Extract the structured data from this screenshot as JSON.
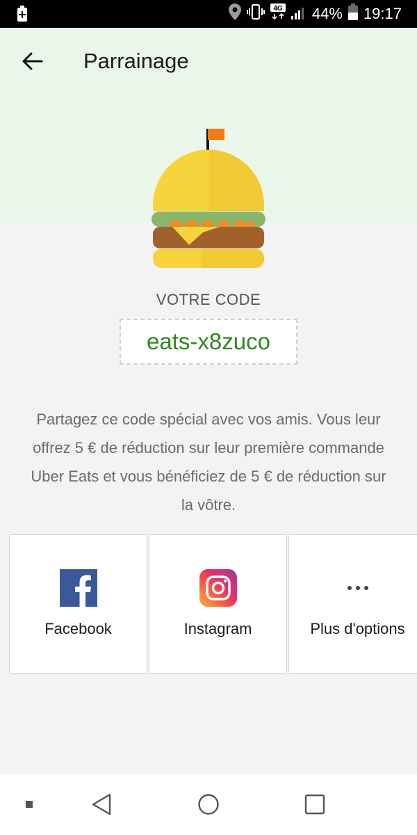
{
  "status_bar": {
    "battery_percent": "44%",
    "time": "19:17",
    "network": "4G"
  },
  "header": {
    "title": "Parrainage",
    "background_color": "#eaf6ea"
  },
  "referral": {
    "code_label": "VOTRE CODE",
    "code": "eats-x8zuco",
    "code_color": "#2d8a1e",
    "description": "Partagez ce code spécial avec vos amis. Vous leur offrez 5 € de réduction sur leur première commande Uber Eats et vous bénéficiez de 5 € de réduction sur la vôtre."
  },
  "share_options": [
    {
      "label": "Facebook",
      "icon": "facebook-icon"
    },
    {
      "label": "Instagram",
      "icon": "instagram-icon"
    },
    {
      "label": "Plus d'options",
      "icon": "more-options-icon"
    }
  ],
  "icons": {
    "back": "back-arrow-icon",
    "burger": "burger-illustration",
    "nav_back": "nav-back-icon",
    "nav_home": "nav-home-icon",
    "nav_recents": "nav-recents-icon"
  }
}
